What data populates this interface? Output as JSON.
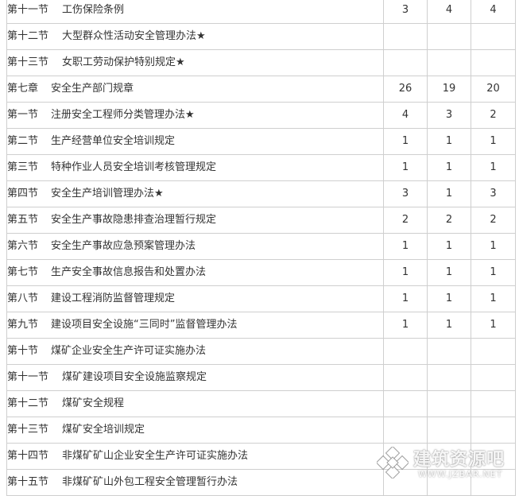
{
  "table": {
    "rows": [
      {
        "label": "第十一节",
        "title": "工伤保险条例",
        "c1": "3",
        "c2": "4",
        "c3": "4"
      },
      {
        "label": "第十二节",
        "title": "大型群众性活动安全管理办法★",
        "c1": "",
        "c2": "",
        "c3": ""
      },
      {
        "label": "第十三节",
        "title": "女职工劳动保护特别规定★",
        "c1": "",
        "c2": "",
        "c3": ""
      },
      {
        "label": "第七章",
        "title": "安全生产部门规章",
        "c1": "26",
        "c2": "19",
        "c3": "20"
      },
      {
        "label": "第一节",
        "title": "注册安全工程师分类管理办法★",
        "c1": "4",
        "c2": "3",
        "c3": "2"
      },
      {
        "label": "第二节",
        "title": "生产经营单位安全培训规定",
        "c1": "1",
        "c2": "1",
        "c3": "1"
      },
      {
        "label": "第三节",
        "title": "特种作业人员安全培训考核管理规定",
        "c1": "1",
        "c2": "1",
        "c3": "1"
      },
      {
        "label": "第四节",
        "title": "安全生产培训管理办法★",
        "c1": "3",
        "c2": "1",
        "c3": "3"
      },
      {
        "label": "第五节",
        "title": "安全生产事故隐患排查治理暂行规定",
        "c1": "2",
        "c2": "2",
        "c3": "2"
      },
      {
        "label": "第六节",
        "title": "安全生产事故应急预案管理办法",
        "c1": "1",
        "c2": "1",
        "c3": "1"
      },
      {
        "label": "第七节",
        "title": "生产安全事故信息报告和处置办法",
        "c1": "1",
        "c2": "1",
        "c3": "1"
      },
      {
        "label": "第八节",
        "title": "建设工程消防监督管理规定",
        "c1": "1",
        "c2": "1",
        "c3": "1"
      },
      {
        "label": "第九节",
        "title": "建设项目安全设施“三同时”监督管理办法",
        "c1": "1",
        "c2": "1",
        "c3": "1"
      },
      {
        "label": "第十节",
        "title": "煤矿企业安全生产许可证实施办法",
        "c1": "",
        "c2": "",
        "c3": ""
      },
      {
        "label": "第十一节",
        "title": "煤矿建设项目安全设施监察规定",
        "c1": "",
        "c2": "",
        "c3": ""
      },
      {
        "label": "第十二节",
        "title": "煤矿安全规程",
        "c1": "",
        "c2": "",
        "c3": ""
      },
      {
        "label": "第十三节",
        "title": "煤矿安全培训规定",
        "c1": "",
        "c2": "",
        "c3": ""
      },
      {
        "label": "第十四节",
        "title": "非煤矿矿山企业安全生产许可证实施办法",
        "c1": "",
        "c2": "",
        "c3": ""
      },
      {
        "label": "第十五节",
        "title": "非煤矿矿山外包工程安全管理暂行办法",
        "c1": "",
        "c2": "",
        "c3": ""
      }
    ]
  },
  "watermark": {
    "name": "建筑资源吧",
    "url": "WWW.JZBAR.NET"
  },
  "colors": {
    "text": "#333333",
    "border": "#cfcfcf"
  }
}
